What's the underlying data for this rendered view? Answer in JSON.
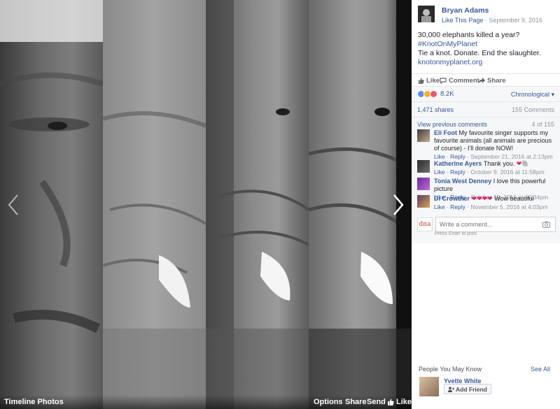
{
  "viewer": {
    "album_title": "Timeline Photos",
    "actions": {
      "options": "Options",
      "share": "Share",
      "send": "Send",
      "like": "Like"
    }
  },
  "post": {
    "page_name": "Bryan Adams",
    "like_page": "Like This Page",
    "date": "September 9, 2016",
    "text_line1": "30,000 elephants killed a year? ",
    "hashtag": "#KnotOnMyPlanet",
    "text_line2": "Tie a knot. Donate. End the slaughter.",
    "url": "knotonmyplanet.org",
    "actions": {
      "like": "Like",
      "comment": "Comment",
      "share": "Share"
    },
    "reaction_count": "8.2K",
    "sort_order": "Chronological",
    "shares": "1,471 shares",
    "comments_count": "155 Comments"
  },
  "comments": {
    "view_previous": "View previous comments",
    "pager": "4 of 155",
    "items": [
      {
        "name": "Eli Foot",
        "text": " My favourite singer supports my favourite animals (all animals are precious of course) - I'll donate NOW!",
        "like": "Like",
        "reply": "Reply",
        "time": "September 21, 2016 at 2:13pm"
      },
      {
        "name": "Katherine Ayers",
        "text": " Thank you. ",
        "like": "Like",
        "reply": "Reply",
        "time": "October 9, 2016 at 11:58pm"
      },
      {
        "name": "Tonia West Denney",
        "text": " I love this powerful picture",
        "like": "Like",
        "reply": "Reply",
        "time": "October 12, 2016 at 10:34pm"
      },
      {
        "name": "Di Crowther",
        "text": " Wow beautiful",
        "like": "Like",
        "reply": "Reply",
        "time": "November 5, 2016 at 4:03pm"
      }
    ],
    "input_placeholder": "Write a comment...",
    "hint": "Press Enter to post.",
    "commenter_logo": "dna"
  },
  "pymk": {
    "heading": "People You May Know",
    "see_all": "See All",
    "person_name": "Yvette White",
    "add_friend": "Add Friend"
  },
  "colors": {
    "link": "#365899",
    "heart": "#e0245e",
    "like_blue": "#5890ff"
  }
}
